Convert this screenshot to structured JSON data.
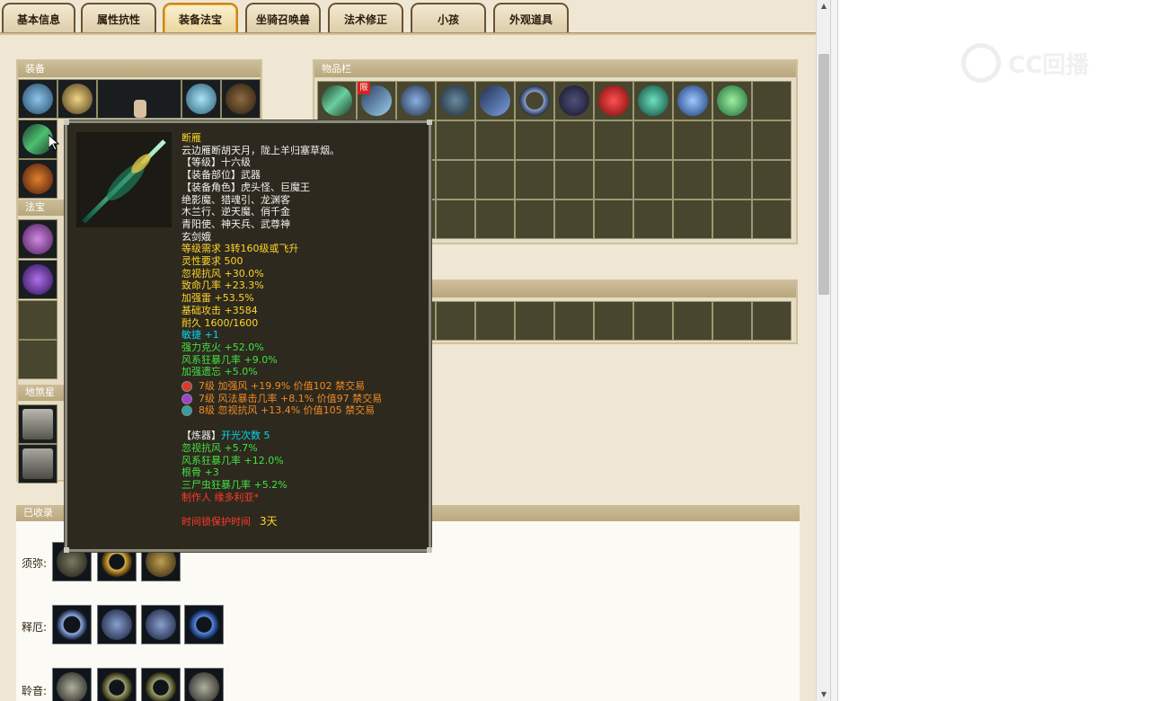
{
  "tabs": [
    {
      "label": "基本信息"
    },
    {
      "label": "属性抗性"
    },
    {
      "label": "装备法宝",
      "active": true
    },
    {
      "label": "坐骑召唤兽"
    },
    {
      "label": "法术修正"
    },
    {
      "label": "小孩"
    },
    {
      "label": "外观道具"
    }
  ],
  "sections": {
    "equipment": "装备",
    "inventory": "物品栏",
    "fabao": "法宝",
    "disha": "地煞星",
    "collected": "已收录"
  },
  "collections": [
    {
      "label": "须弥:"
    },
    {
      "label": "释厄:"
    },
    {
      "label": "聆音:"
    }
  ],
  "inventory": {
    "limit_tag": "限"
  },
  "tooltip": {
    "name": "断雁",
    "description": "云边雁断胡天月，陇上羊归塞草烟。",
    "level": "【等级】十六级",
    "part": "【装备部位】武器",
    "roles_1": "【装备角色】虎头怪、巨魔王",
    "roles_2": "绝影魔、猎魂引、龙渊客",
    "roles_3": "木兰行、逆天魔、俏千金",
    "roles_4": "青阳使、神天兵、武尊神",
    "roles_5": "玄剑娥",
    "req_level": "等级需求 3转160级或飞升",
    "req_spirit": "灵性要求 500",
    "stat_1": "忽视抗风 +30.0%",
    "stat_2": "致命几率 +23.3%",
    "stat_3": "加强雷 +53.5%",
    "stat_4": "基础攻击 +3584",
    "stat_5": "耐久 1600/1600",
    "agility": "敏捷 +1",
    "bonus_1": "强力克火 +52.0%",
    "bonus_2": "风系狂暴几率 +9.0%",
    "bonus_3": "加强遗忘 +5.0%",
    "gems": [
      {
        "text": "7级 加强风 +19.9% 价值102 禁交易",
        "color": "#d83a2a"
      },
      {
        "text": "7级 风法暴击几率 +8.1% 价值97 禁交易",
        "color": "#a040d0"
      },
      {
        "text": "8级 忽视抗风 +13.4% 价值105 禁交易",
        "color": "#30a0a0"
      }
    ],
    "refine_label": "【炼器】",
    "refine_count": "开光次数 5",
    "refine_1": "忽视抗风 +5.7%",
    "refine_2": "风系狂暴几率 +12.0%",
    "refine_3": "根骨 +3",
    "refine_4": "三尸虫狂暴几率 +5.2%",
    "maker": "制作人 缘多利亚*",
    "protect_label": "时间锁保护时间",
    "protect_value": "3天"
  },
  "watermark": {
    "text": "CC回播"
  },
  "colors": {
    "panel_bg": "#efe7d3",
    "slot_bg": "#48462e",
    "tooltip_bg": "#2d291e",
    "accent_tab": "#c7861c"
  }
}
